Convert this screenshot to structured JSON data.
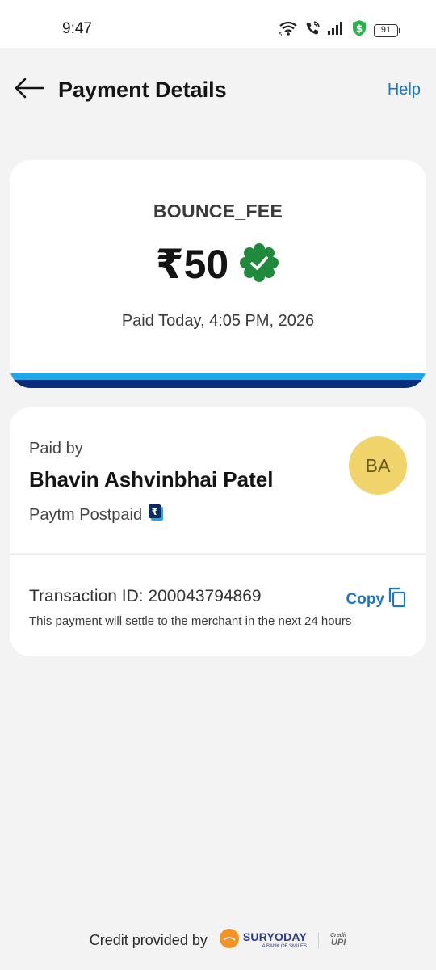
{
  "status_bar": {
    "time": "9:47",
    "battery": "91"
  },
  "header": {
    "title": "Payment Details",
    "help_label": "Help"
  },
  "payment": {
    "purpose": "BOUNCE_FEE",
    "amount": "₹50",
    "paid_time": "Paid Today, 4:05 PM, 2026"
  },
  "payer": {
    "label": "Paid by",
    "name": "Bhavin Ashvinbhai Patel",
    "method": "Paytm Postpaid",
    "initials": "BA"
  },
  "transaction": {
    "id_text": "Transaction ID: 200043794869",
    "copy_label": "Copy",
    "note": "This payment will settle to the merchant in the next 24 hours"
  },
  "footer": {
    "credit_text": "Credit provided by",
    "bank_name": "SURYODAY",
    "bank_tagline": "A BANK OF SMILES",
    "upi_small": "Credit",
    "upi_big": "UPI"
  },
  "colors": {
    "accent": "#1a76c9",
    "success": "#1f8a3b",
    "stripe_light": "#1ba9ec",
    "stripe_dark": "#062e7a",
    "avatar_bg": "#f0d36a"
  }
}
